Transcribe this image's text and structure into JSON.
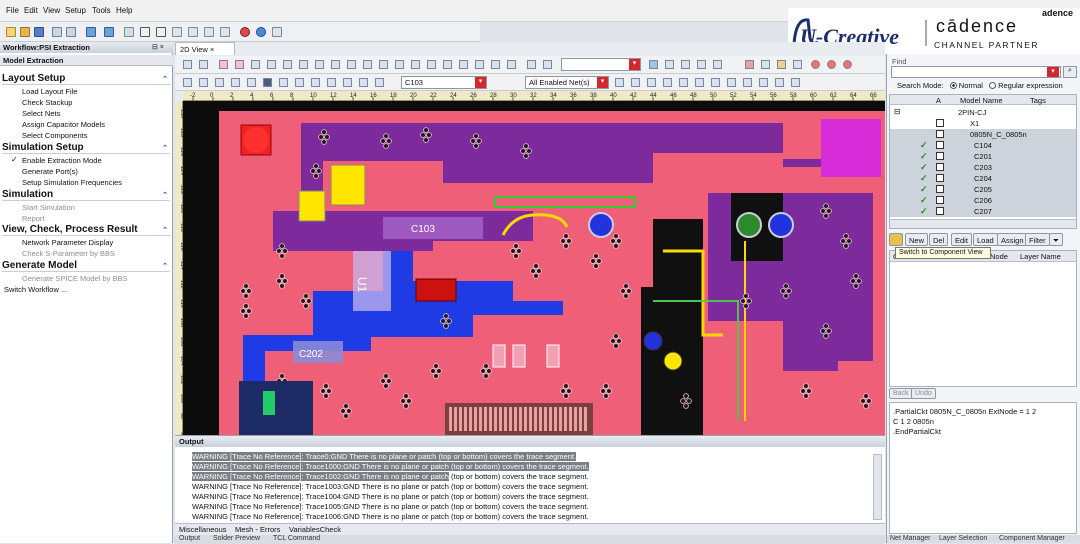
{
  "menu": [
    "File",
    "Edit",
    "View",
    "Setup",
    "Tools",
    "Help"
  ],
  "brand": {
    "logo1": "U-Creative",
    "logo2": "cādence",
    "logo3": "CHANNEL PARTNER",
    "corner": "adence"
  },
  "workflow": {
    "title": "Workflow:PSI Extraction",
    "subtitle": "Model Extraction",
    "sections": [
      {
        "title": "Layout Setup",
        "items": [
          {
            "label": "Load Layout File",
            "enabled": true
          },
          {
            "label": "Check Stackup",
            "enabled": true
          },
          {
            "label": "Select Nets",
            "enabled": true
          },
          {
            "label": "Assign Capacitor Models",
            "enabled": true
          },
          {
            "label": "Select Components",
            "enabled": true
          }
        ]
      },
      {
        "title": "Simulation Setup",
        "items": [
          {
            "label": "Enable Extraction Mode",
            "enabled": true,
            "checked": true
          },
          {
            "label": "Generate Port(s)",
            "enabled": true
          },
          {
            "label": "Setup Simulation Frequencies",
            "enabled": true
          }
        ]
      },
      {
        "title": "Simulation",
        "items": [
          {
            "label": "Start Simulation",
            "enabled": false
          },
          {
            "label": "Report",
            "enabled": false
          }
        ]
      },
      {
        "title": "View, Check, Process Result",
        "items": [
          {
            "label": "Network Parameter Display",
            "enabled": true
          },
          {
            "label": "Check S-Parameter by BBS",
            "enabled": false
          }
        ]
      },
      {
        "title": "Generate Model",
        "items": [
          {
            "label": "Generate SPICE Model by BBS",
            "enabled": false
          }
        ]
      }
    ],
    "switch": "Switch Workflow ..."
  },
  "view": {
    "tab": "2D View",
    "net_combo": "C103",
    "filter_combo": "All Enabled Net(s)",
    "ruler_ticks": [
      "-2",
      "0",
      "2",
      "4",
      "6",
      "8",
      "10",
      "12",
      "14",
      "16",
      "18",
      "20",
      "22",
      "24",
      "26",
      "28",
      "30",
      "32",
      "34",
      "36",
      "38",
      "40",
      "42",
      "44",
      "46",
      "48",
      "50",
      "52",
      "54",
      "56",
      "58",
      "60",
      "62",
      "64",
      "66"
    ],
    "ruler_v": [
      "130",
      "128",
      "126",
      "124",
      "122",
      "120",
      "118",
      "116",
      "114",
      "112",
      "110",
      "108",
      "106",
      "104",
      "102",
      "100",
      "98",
      "96"
    ],
    "labels": {
      "c103": "C103",
      "u1": "U1",
      "c202": "C202"
    }
  },
  "output": {
    "title": "Output",
    "lines": [
      {
        "text": "WARNING [Trace No Reference]: Trace0:GND There is no plane or patch (top or bottom) covers the trace segment.",
        "hl": true
      },
      {
        "text": "WARNING [Trace No Reference]: Trace1000:GND There is no plane or patch (top or bottom) covers the trace segment.",
        "hl": true
      },
      {
        "text": "WARNING [Trace No Reference]: Trace1002:GND There is no plane or patch (top or bottom) covers the trace segment.",
        "hl": true
      },
      {
        "text": "WARNING [Trace No Reference]: Trace1003:GND There is no plane or patch (top or bottom) covers the trace segment.",
        "hl": false
      },
      {
        "text": "WARNING [Trace No Reference]: Trace1004:GND There is no plane or patch (top or bottom) covers the trace segment.",
        "hl": false
      },
      {
        "text": "WARNING [Trace No Reference]: Trace1005:GND There is no plane or patch (top or bottom) covers the trace segment.",
        "hl": false
      },
      {
        "text": "WARNING [Trace No Reference]: Trace1006:GND There is no plane or patch (top or bottom) covers the trace segment.",
        "hl": false
      }
    ],
    "tabs": [
      "Miscellaneous",
      "Mesh - Errors",
      "VariablesCheck"
    ],
    "bottom_tabs": [
      "Output",
      "Solder Preview",
      "TCL Command"
    ]
  },
  "find": {
    "label": "Find",
    "search_mode_label": "Search Mode:",
    "mode_normal": "Normal",
    "mode_regex": "Regular expression"
  },
  "tree": {
    "headers": [
      "A",
      "Model Name",
      "Tags"
    ],
    "rows": [
      {
        "name": "2PIN-CJ",
        "checked": false,
        "sel": false,
        "level": 0
      },
      {
        "name": "X1",
        "checked": false,
        "sel": false,
        "level": 1
      },
      {
        "name": "0805N_C_0805n",
        "checked": false,
        "sel": true,
        "level": 1
      },
      {
        "name": "C104",
        "checked": true,
        "sel": true,
        "level": 2
      },
      {
        "name": "C201",
        "checked": true,
        "sel": true,
        "level": 2
      },
      {
        "name": "C203",
        "checked": true,
        "sel": true,
        "level": 2
      },
      {
        "name": "C204",
        "checked": true,
        "sel": true,
        "level": 2
      },
      {
        "name": "C205",
        "checked": true,
        "sel": true,
        "level": 2
      },
      {
        "name": "C206",
        "checked": true,
        "sel": true,
        "level": 2
      },
      {
        "name": "C207",
        "checked": true,
        "sel": true,
        "level": 2
      }
    ]
  },
  "buttons": [
    "New",
    "Del",
    "Edit",
    "Load",
    "Assign",
    "Filter"
  ],
  "tooltip": "Switch to Component View",
  "grid2": {
    "headers": [
      "C",
      "Node",
      "Layer Name"
    ]
  },
  "edit_buttons": [
    "Back",
    "Undo"
  ],
  "spice": [
    ".PartialCkt 0805N_C_0805n ExtNode = 1 2",
    "C 1 2 0805n",
    ".EndPartialCkt"
  ],
  "right_bottom_tabs": [
    "Net Manager",
    "Layer Selection",
    "Component Manager"
  ]
}
